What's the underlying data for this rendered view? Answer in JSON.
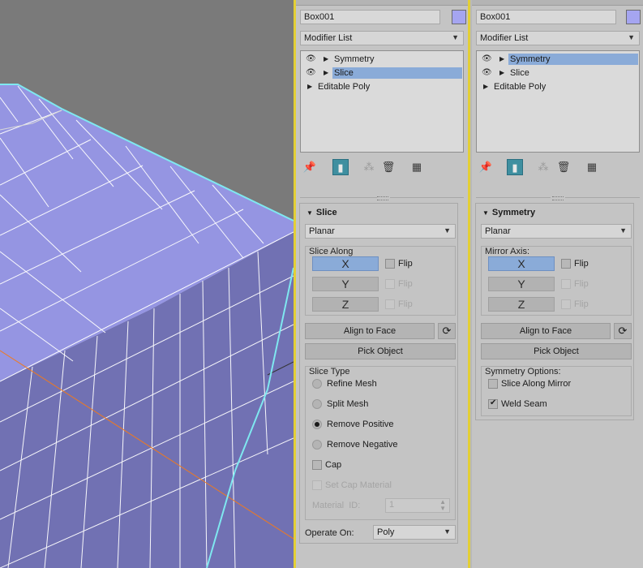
{
  "viewport": {
    "colors": {
      "background": "#7a7a7a",
      "face_top": "#9494e0",
      "face_side": "#7272b4",
      "edges": "#ffffff",
      "selection_outline": "#7fe8f0",
      "slice_plane": "#f07a1e"
    }
  },
  "left_panel": {
    "object_name": "Box001",
    "object_color": "#a5a5f0",
    "modifier_list_label": "Modifier List",
    "stack": [
      {
        "label": "Symmetry",
        "has_eye": true,
        "selected": false
      },
      {
        "label": "Slice",
        "has_eye": true,
        "selected": true
      },
      {
        "label": "Editable Poly",
        "has_eye": false,
        "selected": false
      }
    ],
    "toolbar_icons": [
      "pin-stack-icon",
      "show-end-result-icon",
      "make-unique-icon",
      "remove-modifier-icon",
      "configure-modifier-sets-icon"
    ],
    "rollout": {
      "title": "Slice",
      "mode": "Planar",
      "slice_along_label": "Slice Along",
      "axes": [
        {
          "label": "X",
          "active": true,
          "flip_label": "Flip",
          "flip_enabled": true
        },
        {
          "label": "Y",
          "active": false,
          "flip_label": "Flip",
          "flip_enabled": false
        },
        {
          "label": "Z",
          "active": false,
          "flip_label": "Flip",
          "flip_enabled": false
        }
      ],
      "align_to_face": "Align to Face",
      "pick_object": "Pick Object",
      "slice_type_label": "Slice Type",
      "slice_types": [
        {
          "label": "Refine Mesh",
          "selected": false
        },
        {
          "label": "Split Mesh",
          "selected": false
        },
        {
          "label": "Remove Positive",
          "selected": true
        },
        {
          "label": "Remove Negative",
          "selected": false
        }
      ],
      "cap_label": "Cap",
      "set_cap_material_label": "Set Cap Material",
      "material_id_label": "Material  ID:",
      "material_id_value": "1",
      "operate_on_label": "Operate On:",
      "operate_on_value": "Poly"
    }
  },
  "right_panel": {
    "object_name": "Box001",
    "object_color": "#a5a5f0",
    "modifier_list_label": "Modifier List",
    "stack": [
      {
        "label": "Symmetry",
        "has_eye": true,
        "selected": true
      },
      {
        "label": "Slice",
        "has_eye": true,
        "selected": false
      },
      {
        "label": "Editable Poly",
        "has_eye": false,
        "selected": false
      }
    ],
    "rollout": {
      "title": "Symmetry",
      "mode": "Planar",
      "mirror_axis_label": "Mirror Axis:",
      "axes": [
        {
          "label": "X",
          "active": true,
          "flip_label": "Flip",
          "flip_enabled": true
        },
        {
          "label": "Y",
          "active": false,
          "flip_label": "Flip",
          "flip_enabled": false
        },
        {
          "label": "Z",
          "active": false,
          "flip_label": "Flip",
          "flip_enabled": false
        }
      ],
      "align_to_face": "Align to Face",
      "pick_object": "Pick Object",
      "options_label": "Symmetry Options:",
      "slice_along_mirror_label": "Slice Along Mirror",
      "slice_along_mirror_checked": false,
      "weld_seam_label": "Weld Seam",
      "weld_seam_checked": true
    }
  }
}
